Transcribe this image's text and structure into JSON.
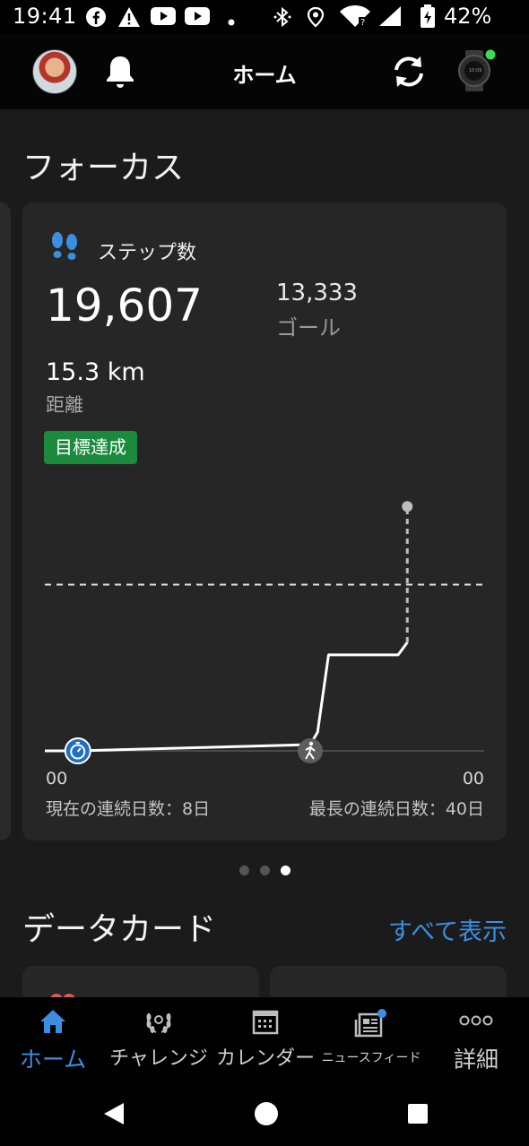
{
  "status_bar": {
    "time": "19:41",
    "battery": "42%",
    "icons": [
      "facebook-icon",
      "alert-icon",
      "youtube-icon",
      "youtube-icon",
      "notification-dot",
      "bluetooth-icon",
      "location-icon",
      "wifi-icon",
      "signal-icon",
      "battery-icon"
    ]
  },
  "app_bar": {
    "title": "ホーム",
    "left_icons": [
      "avatar",
      "bell-icon"
    ],
    "right_icons": [
      "sync-icon",
      "watch-icon"
    ]
  },
  "focus": {
    "section_title": "フォーカス",
    "card": {
      "title": "ステップ数",
      "icon": "footsteps-icon",
      "steps": "19,607",
      "goal_value": "13,333",
      "goal_label": "ゴール",
      "distance_value": "15.3 km",
      "distance_label": "距離",
      "badge": "目標達成",
      "axis_left": "00",
      "axis_right": "00",
      "current_streak": "現在の連続日数：8日",
      "longest_streak": "最長の連続日数：40日"
    },
    "pager": {
      "count": 3,
      "active": 3
    }
  },
  "chart_data": {
    "type": "line",
    "title": "",
    "xlabel": "",
    "ylabel": "",
    "x_ticks": [
      "00",
      "00"
    ],
    "x_range": [
      0,
      24
    ],
    "ylim": [
      0,
      22000
    ],
    "goal_line": 13333,
    "series": [
      {
        "x": [
          0,
          1.8,
          14.5,
          14.9,
          15.5,
          19.3,
          19.8
        ],
        "y": [
          0,
          0,
          500,
          1500,
          7700,
          7700,
          8700
        ]
      }
    ],
    "projection": {
      "x": 19.8,
      "from": 8700,
      "to": 19607
    },
    "markers": [
      {
        "x": 1.8,
        "icon": "timer-icon"
      },
      {
        "x": 14.5,
        "icon": "walking-icon"
      }
    ]
  },
  "data_cards": {
    "section_title": "データカード",
    "view_all": "すべて表示"
  },
  "bottom_nav": {
    "items": [
      {
        "label": "ホーム",
        "icon": "home-icon",
        "active": true
      },
      {
        "label": "チャレンジ",
        "icon": "laurel-icon",
        "active": false
      },
      {
        "label": "カレンダー",
        "icon": "calendar-icon",
        "active": false
      },
      {
        "label": "ニュースフィード",
        "icon": "newsfeed-icon",
        "active": false
      },
      {
        "label": "詳細",
        "icon": "more-icon",
        "active": false
      }
    ]
  },
  "colors": {
    "accent": "#3b8fe0",
    "badge": "#1a8a3c",
    "background": "#1b1b1b",
    "card": "#262626",
    "notification": "#3b8fe0",
    "watch_status": "#3ddc54"
  }
}
